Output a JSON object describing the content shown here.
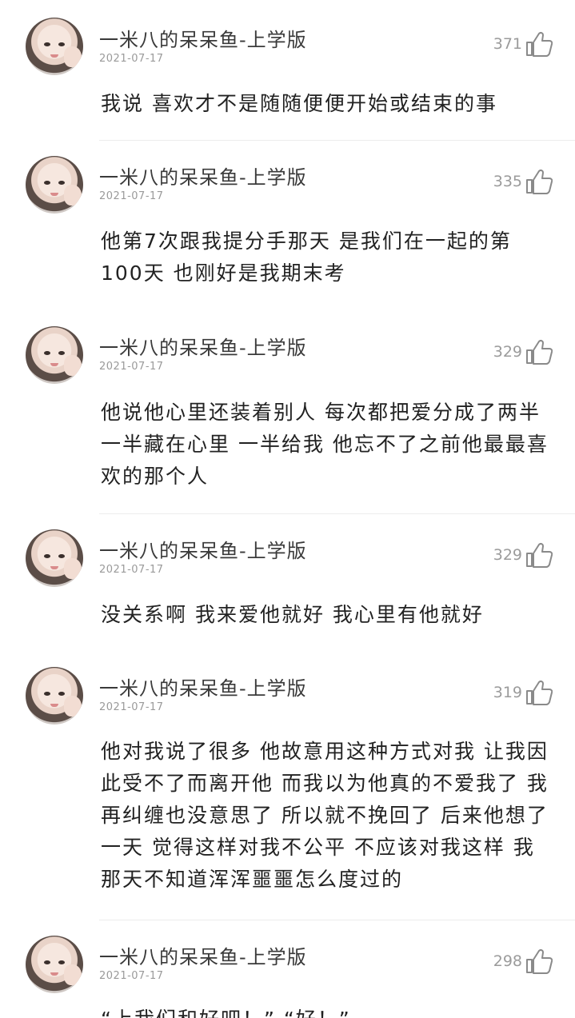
{
  "comments": [
    {
      "user": "一米八的呆呆鱼-上学版",
      "date": "2021-07-17",
      "likes": "371",
      "text": "我说 喜欢才不是随随便便开始或结束的事"
    },
    {
      "user": "一米八的呆呆鱼-上学版",
      "date": "2021-07-17",
      "likes": "335",
      "text": "他第7次跟我提分手那天 是我们在一起的第100天 也刚好是我期末考"
    },
    {
      "user": "一米八的呆呆鱼-上学版",
      "date": "2021-07-17",
      "likes": "329",
      "text": "他说他心里还装着别人 每次都把爱分成了两半 一半藏在心里 一半给我 他忘不了之前他最最喜欢的那个人"
    },
    {
      "user": "一米八的呆呆鱼-上学版",
      "date": "2021-07-17",
      "likes": "329",
      "text": "没关系啊 我来爱他就好 我心里有他就好"
    },
    {
      "user": "一米八的呆呆鱼-上学版",
      "date": "2021-07-17",
      "likes": "319",
      "text": "他对我说了很多 他故意用这种方式对我 让我因此受不了而离开他 而我以为他真的不爱我了 我再纠缠也没意思了 所以就不挽回了 后来他想了一天 觉得这样对我不公平 不应该对我这样 我那天不知道浑浑噩噩怎么度过的"
    },
    {
      "user": "一米八的呆呆鱼-上学版",
      "date": "2021-07-17",
      "likes": "298",
      "text": "“上我们和好吧！” “好！”"
    }
  ]
}
